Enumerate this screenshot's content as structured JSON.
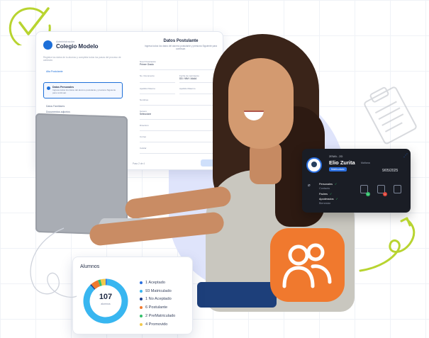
{
  "form_window": {
    "school_top": "Administración",
    "school_name": "Colegio Modelo",
    "description": "Registra los datos de tu alumno y completa todos los pasos del proceso de admisión.",
    "steps": [
      {
        "label": "Alta Postulante"
      },
      {
        "label": "Datos Personales",
        "description": "Ingresa todos los datos del alumno postulante y presiona Siguiente para continuar."
      },
      {
        "label": "Datos Familiares"
      },
      {
        "label": "Documentos adjuntos"
      }
    ],
    "title": "Datos Postulante",
    "subtitle": "Ingresa todos los datos del alumno postulante y presiona Siguiente para continuar.",
    "fields": {
      "level_label": "Nivel Postulación",
      "level_value": "Primer Grado",
      "dni_label": "No. Documento",
      "birth_label": "Fecha de nacimiento",
      "birth_value": "DD / MM / AAAA",
      "lastname1_label": "Apellido Paterno",
      "lastname2_label": "Apellido Materno",
      "name_label": "Nombres",
      "gender_label": "Género",
      "gender_value": "Seleccione",
      "address_label": "Dirección",
      "email_label": "Correo",
      "phone_label": "Celular"
    },
    "footer": "Paso 2 de 4"
  },
  "student_card": {
    "grade": "2EMA - 2D",
    "name": "Elio Zurita",
    "shift": "Mañana",
    "status": "Matriculado",
    "date": "9/05/2025",
    "rows": [
      {
        "label": "Personales",
        "check": "✓"
      },
      {
        "label": "Contacto",
        "check": ""
      },
      {
        "label": "Padres",
        "check": "✓"
      },
      {
        "label": "Apoderados",
        "check": "✓"
      },
      {
        "label": "Bienestar",
        "check": ""
      }
    ],
    "badges": [
      "1",
      "1"
    ]
  },
  "stats_card": {
    "title": "Alumnos",
    "total": "107",
    "total_label": "alumnos",
    "legend": [
      {
        "label": "1 Aceptado",
        "value": 1,
        "color": "#2b6fe0"
      },
      {
        "label": "93 Matriculado",
        "value": 93,
        "color": "#38b6f0"
      },
      {
        "label": "1 No Aceptado",
        "value": 1,
        "color": "#1b3f8f"
      },
      {
        "label": "6 Postulante",
        "value": 6,
        "color": "#f0792e"
      },
      {
        "label": "2 PreMatriculado",
        "value": 2,
        "color": "#33c06b"
      },
      {
        "label": "4 Promovido",
        "value": 4,
        "color": "#f2c94c"
      }
    ]
  },
  "colors": {
    "accent": "#1d6fd8",
    "orange": "#f0792e",
    "check_green": "#b8d430"
  },
  "icons": [
    "check-circle-icon",
    "clipboard-icon",
    "group-users-icon",
    "paperclip-icon",
    "document-icon"
  ]
}
